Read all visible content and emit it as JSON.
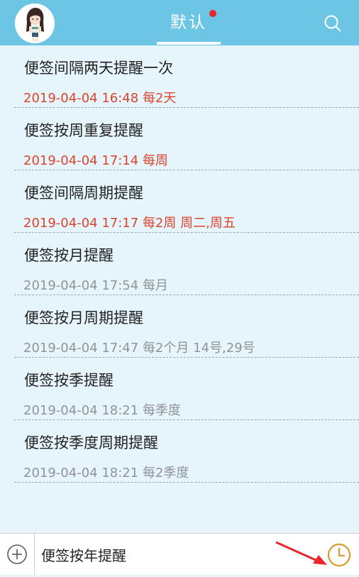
{
  "header": {
    "tab_label": "默认",
    "has_unread": true,
    "avatar_icon": "girl-avatar",
    "search_icon": "search-icon",
    "background_color": "#6cc5e4"
  },
  "notes": [
    {
      "title": "便签间隔两天提醒一次",
      "datetime": "2019-04-04 16:48",
      "repeat": "每2天",
      "active": true
    },
    {
      "title": "便签按周重复提醒",
      "datetime": "2019-04-04 17:14",
      "repeat": "每周",
      "active": true
    },
    {
      "title": "便签间隔周期提醒",
      "datetime": "2019-04-04 17:17",
      "repeat": "每2周 周二,周五",
      "active": true
    },
    {
      "title": "便签按月提醒",
      "datetime": "2019-04-04 17:54",
      "repeat": "每月",
      "active": false
    },
    {
      "title": "便签按月周期提醒",
      "datetime": "2019-04-04 17:47",
      "repeat": "每2个月 14号,29号",
      "active": false
    },
    {
      "title": "便签按季提醒",
      "datetime": "2019-04-04 18:21",
      "repeat": "每季度",
      "active": false
    },
    {
      "title": "便签按季度周期提醒",
      "datetime": "2019-04-04 18:21",
      "repeat": "每2季度",
      "active": false
    }
  ],
  "composer": {
    "value": "便签按年提醒",
    "add_icon": "plus-circle-icon",
    "reminder_icon": "clock-icon"
  },
  "colors": {
    "active_reminder": "#d9442c",
    "past_reminder": "#8f9499",
    "clock_accent": "#d99a2b",
    "annotation_arrow": "#e8262c"
  }
}
